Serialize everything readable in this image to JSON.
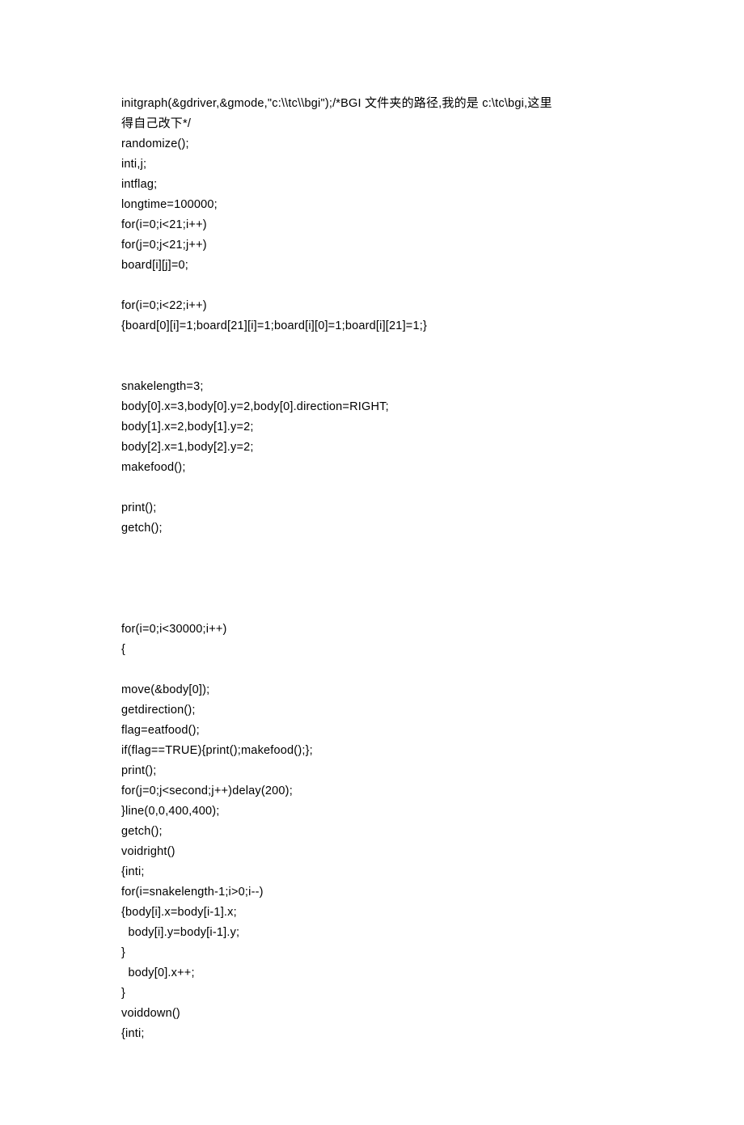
{
  "lines": [
    {
      "type": "text",
      "value": "initgraph(&gdriver,&gmode,\"c:\\\\tc\\\\bgi\");/*BGI 文件夹的路径,我的是 c:\\tc\\bgi,这里"
    },
    {
      "type": "text",
      "value": "得自己改下*/"
    },
    {
      "type": "text",
      "value": "randomize();"
    },
    {
      "type": "text",
      "value": "inti,j;"
    },
    {
      "type": "text",
      "value": "intflag;"
    },
    {
      "type": "text",
      "value": "longtime=100000;"
    },
    {
      "type": "text",
      "value": "for(i=0;i<21;i++)"
    },
    {
      "type": "text",
      "value": "for(j=0;j<21;j++)"
    },
    {
      "type": "text",
      "value": "board[i][j]=0;"
    },
    {
      "type": "blank"
    },
    {
      "type": "text",
      "value": "for(i=0;i<22;i++)"
    },
    {
      "type": "text",
      "value": "{board[0][i]=1;board[21][i]=1;board[i][0]=1;board[i][21]=1;}"
    },
    {
      "type": "blank"
    },
    {
      "type": "blank"
    },
    {
      "type": "text",
      "value": "snakelength=3;"
    },
    {
      "type": "text",
      "value": "body[0].x=3,body[0].y=2,body[0].direction=RIGHT;"
    },
    {
      "type": "text",
      "value": "body[1].x=2,body[1].y=2;"
    },
    {
      "type": "text",
      "value": "body[2].x=1,body[2].y=2;"
    },
    {
      "type": "text",
      "value": "makefood();"
    },
    {
      "type": "blank"
    },
    {
      "type": "text",
      "value": "print();"
    },
    {
      "type": "text",
      "value": "getch();"
    },
    {
      "type": "blank"
    },
    {
      "type": "blank"
    },
    {
      "type": "blank"
    },
    {
      "type": "blank"
    },
    {
      "type": "text",
      "value": "for(i=0;i<30000;i++)"
    },
    {
      "type": "text",
      "value": "{"
    },
    {
      "type": "blank"
    },
    {
      "type": "text",
      "value": "move(&body[0]);"
    },
    {
      "type": "text",
      "value": "getdirection();"
    },
    {
      "type": "text",
      "value": "flag=eatfood();"
    },
    {
      "type": "text",
      "value": "if(flag==TRUE){print();makefood();};"
    },
    {
      "type": "text",
      "value": "print();"
    },
    {
      "type": "text",
      "value": "for(j=0;j<second;j++)delay(200);"
    },
    {
      "type": "text",
      "value": "}line(0,0,400,400);"
    },
    {
      "type": "text",
      "value": "getch();"
    },
    {
      "type": "text",
      "value": "voidright()"
    },
    {
      "type": "text",
      "value": "{inti;"
    },
    {
      "type": "text",
      "value": "for(i=snakelength-1;i>0;i--)"
    },
    {
      "type": "text",
      "value": "{body[i].x=body[i-1].x;"
    },
    {
      "type": "text",
      "value": "  body[i].y=body[i-1].y;"
    },
    {
      "type": "text",
      "value": "}"
    },
    {
      "type": "text",
      "value": "  body[0].x++;"
    },
    {
      "type": "text",
      "value": "}"
    },
    {
      "type": "text",
      "value": "voiddown()"
    },
    {
      "type": "text",
      "value": "{inti;"
    }
  ]
}
